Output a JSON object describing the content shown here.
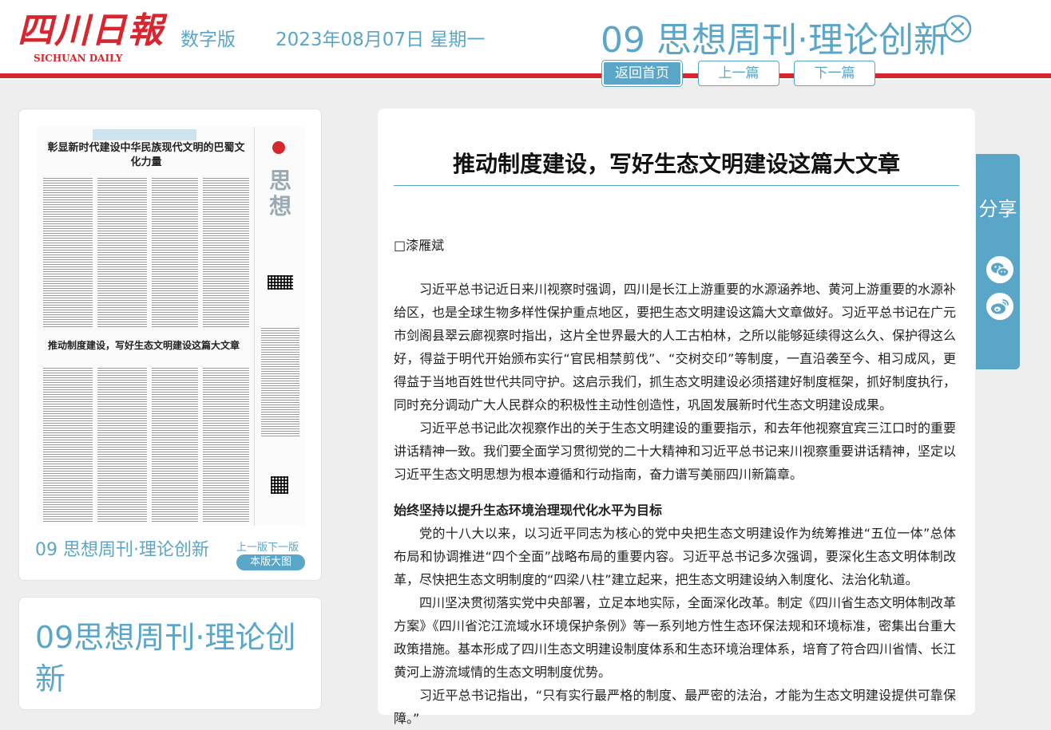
{
  "header": {
    "logo_cn": "四川日報",
    "logo_en": "SICHUAN DAILY",
    "edition": "数字版",
    "date": "2023年08月07日 星期一",
    "page_title": "09 思想周刊·理论创新",
    "nav": {
      "home": "返回首页",
      "prev": "上一篇",
      "next": "下一篇"
    }
  },
  "thumbnail": {
    "headline_1": "彰显新时代建设中华民族现代文明的巴蜀文化力量",
    "headline_2": "推动制度建设，写好生态文明建设这篇大文章",
    "side_title": "思想",
    "caption": "09 思想周刊·理论创新",
    "prev_next": "上一版下一版",
    "big_pic": "本版大图"
  },
  "page_list": {
    "title": "09思想周刊·理论创新"
  },
  "article": {
    "title": "推动制度建设，写好生态文明建设这篇大文章",
    "author": "□漆雁斌",
    "p1": "习近平总书记近日来川视察时强调，四川是长江上游重要的水源涵养地、黄河上游重要的水源补给区，也是全球生物多样性保护重点地区，要把生态文明建设这篇大文章做好。习近平总书记在广元市剑阁县翠云廊视察时指出，这片全世界最大的人工古柏林，之所以能够延续得这么久、保护得这么好，得益于明代开始颁布实行“官民相禁剪伐”、“交树交印”等制度，一直沿袭至今、相习成风，更得益于当地百姓世代共同守护。这启示我们，抓生态文明建设必须搭建好制度框架，抓好制度执行，同时充分调动广大人民群众的积极性主动性创造性，巩固发展新时代生态文明建设成果。",
    "p2": "习近平总书记此次视察作出的关于生态文明建设的重要指示，和去年他视察宜宾三江口时的重要讲话精神一致。我们要全面学习贯彻党的二十大精神和习近平总书记来川视察重要讲话精神，坚定以习近平生态文明思想为根本遵循和行动指南，奋力谱写美丽四川新篇章。",
    "h1": "始终坚持以提升生态环境治理现代化水平为目标",
    "p3": "党的十八大以来，以习近平同志为核心的党中央把生态文明建设作为统筹推进“五位一体”总体布局和协调推进“四个全面”战略布局的重要内容。习近平总书记多次强调，要深化生态文明体制改革，尽快把生态文明制度的“四梁八柱”建立起来，把生态文明建设纳入制度化、法治化轨道。",
    "p4": "四川坚决贯彻落实党中央部署，立足本地实际，全面深化改革。制定《四川省生态文明体制改革方案》《四川省沱江流域水环境保护条例》等一系列地方性生态环保法规和环境标准，密集出台重大政策措施。基本形成了四川生态文明建设制度体系和生态环境治理体系，培育了符合四川省情、长江黄河上游流域情的生态文明制度优势。",
    "p5": "习近平总书记指出，“只有实行最严格的制度、最严密的法治，才能为生态文明建设提供可靠保障。”"
  },
  "share": {
    "label": "分享",
    "icons": [
      "wechat-icon",
      "weibo-icon"
    ]
  },
  "colors": {
    "accent": "#5aa6c8",
    "brand_red": "#d8262f"
  }
}
